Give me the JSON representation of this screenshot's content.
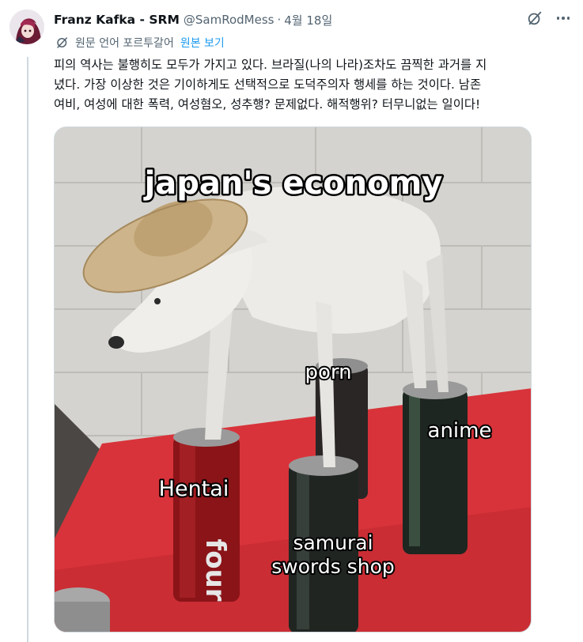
{
  "post": {
    "author": {
      "display_name": "Franz Kafka - SRM",
      "handle": "@SamRodMess",
      "avatar_icon": "anime-avatar-icon"
    },
    "separator": "·",
    "date": "4월 18일",
    "icons": {
      "grok": "grok-icon",
      "more": "more-options-icon",
      "translate": "translate-icon"
    },
    "translation": {
      "label": "원문 언어 포르투갈어",
      "show_original": "원본 보기"
    },
    "text_lines": [
      "피의 역사는 불행히도 모두가 가지고 있다. 브라질(나의 나라)조차도 끔찍한 과거를 지",
      "녔다. 가장 이상한 것은 기이하게도 선택적으로 도덕주의자 행세를 하는 것이다. 남존",
      "여비, 여성에 대한 폭력, 여성혐오, 성추행? 문제없다. 해적행위? 터무니없는 일이다!"
    ],
    "media": {
      "labels": {
        "top": "japan's economy",
        "porn": "porn",
        "anime": "anime",
        "hentai": "Hentai",
        "samurai_line1": "samurai",
        "samurai_line2": "swords shop"
      },
      "can_text": "four"
    }
  },
  "colors": {
    "accent": "#1d9bf0",
    "secondary_text": "#536471",
    "primary_text": "#0f1419"
  }
}
